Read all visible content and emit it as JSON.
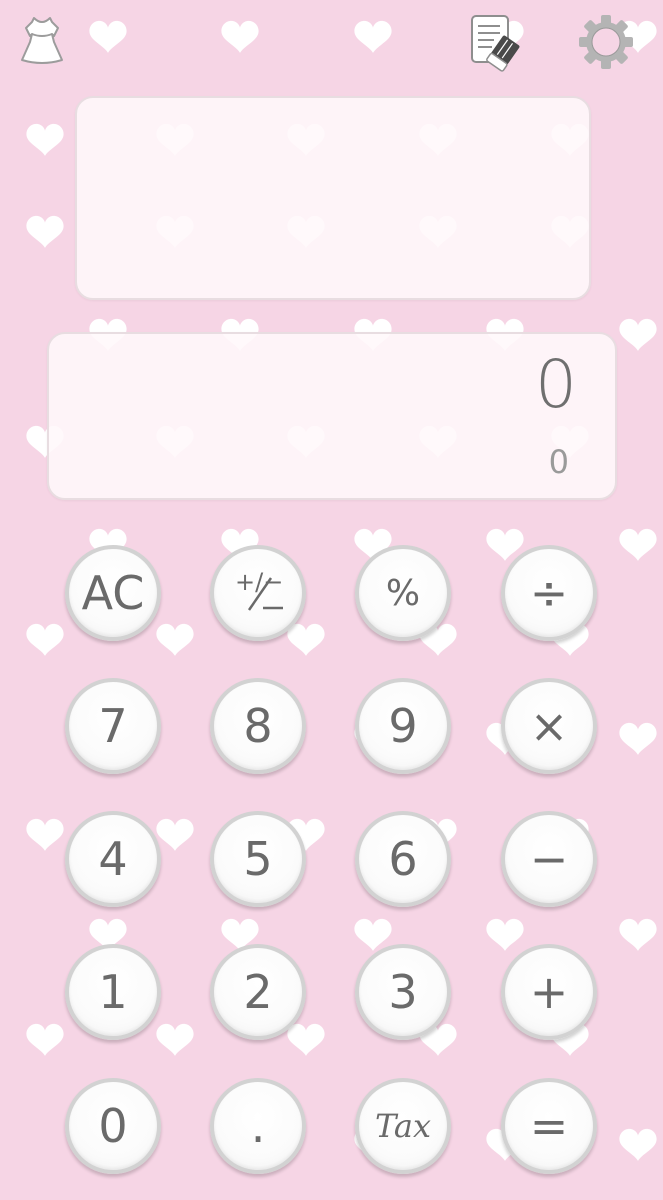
{
  "toolbar": {
    "theme_icon": "dress-icon",
    "clear_icon": "clear-history-icon",
    "settings_icon": "gear-icon"
  },
  "history": {
    "entries": []
  },
  "display": {
    "value": "0",
    "sub_value": "0"
  },
  "keys": [
    [
      "AC",
      "+/−",
      "%",
      "÷"
    ],
    [
      "7",
      "8",
      "9",
      "×"
    ],
    [
      "4",
      "5",
      "6",
      "−"
    ],
    [
      "1",
      "2",
      "3",
      "+"
    ],
    [
      "0",
      ".",
      "Tax",
      "="
    ]
  ],
  "colors": {
    "background": "#f6d5e5",
    "heart": "#ffffff",
    "key_text": "#6a6a6a",
    "key_border": "#d2d2d2"
  }
}
